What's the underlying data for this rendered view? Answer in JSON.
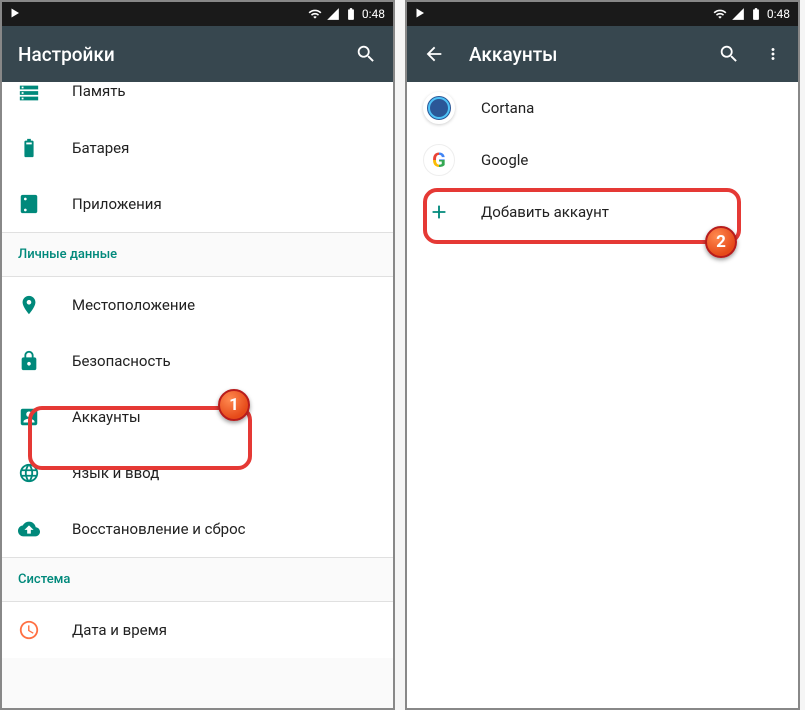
{
  "status": {
    "time": "0:48"
  },
  "left": {
    "title": "Настройки",
    "items": {
      "memory": "Память",
      "battery": "Батарея",
      "apps": "Приложения",
      "location": "Местоположение",
      "security": "Безопасность",
      "accounts": "Аккаунты",
      "language": "Язык и ввод",
      "backup": "Восстановление и сброс",
      "datetime": "Дата и время"
    },
    "sections": {
      "personal": "Личные данные",
      "system": "Система"
    }
  },
  "right": {
    "title": "Аккаунты",
    "accounts": {
      "cortana": "Cortana",
      "google": "Google"
    },
    "add": "Добавить аккаунт"
  },
  "badges": {
    "one": "1",
    "two": "2"
  }
}
